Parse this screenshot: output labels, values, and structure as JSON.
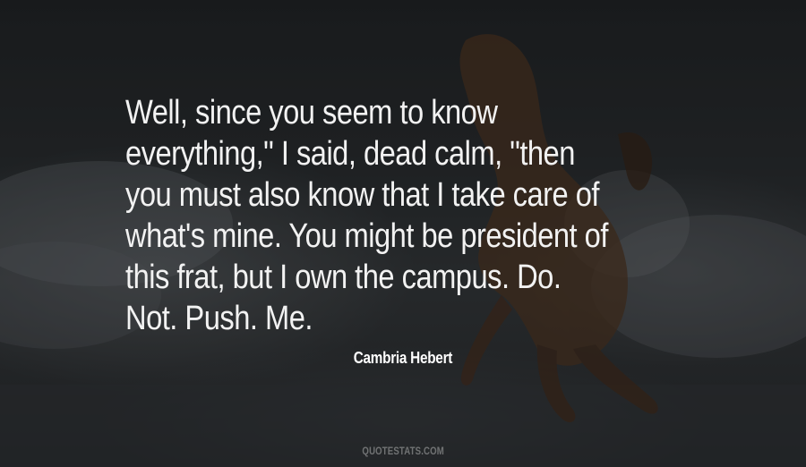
{
  "quote": {
    "lines": [
      "Well, since you seem to know",
      "everything,\" I said, dead calm, \"then",
      "you must also know that I take care of",
      "what's mine. You might be president of",
      "this frat, but I own the campus. Do.",
      "Not. Push. Me."
    ]
  },
  "author": "Cambria Hebert",
  "watermark": "QUOTESTATS.COM"
}
